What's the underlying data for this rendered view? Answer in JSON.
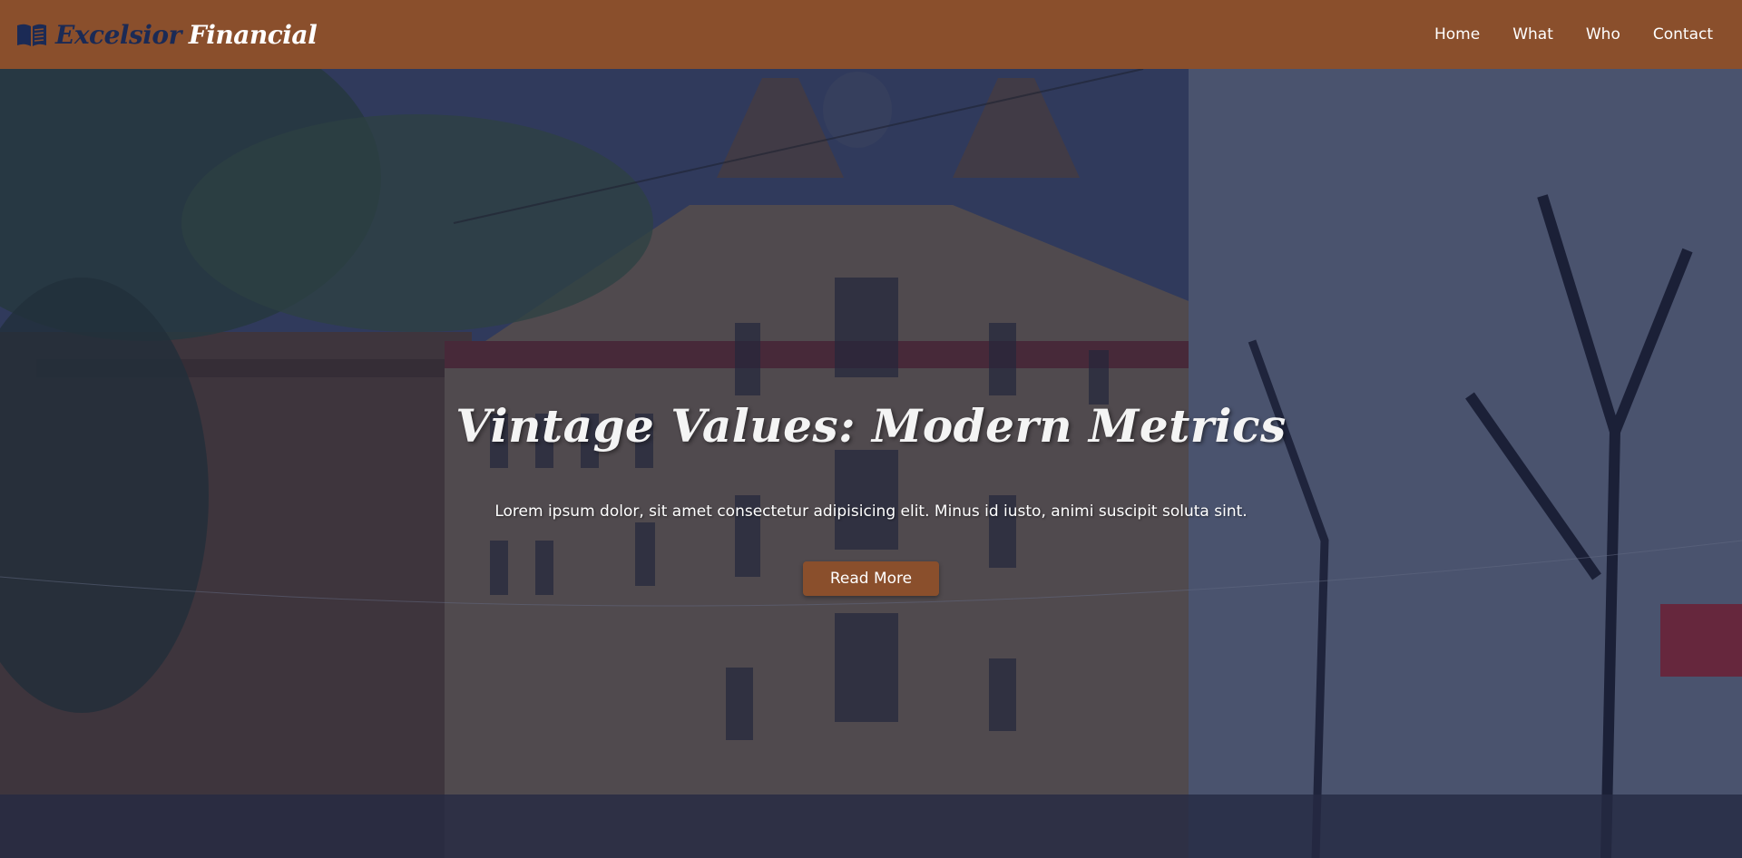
{
  "brand": {
    "word_1": "Excelsior",
    "word_2": "Financial",
    "icon": "open-book-icon"
  },
  "nav": {
    "items": [
      {
        "label": "Home"
      },
      {
        "label": "What"
      },
      {
        "label": "Who"
      },
      {
        "label": "Contact"
      }
    ]
  },
  "hero": {
    "title": "Vintage Values: Modern Metrics",
    "subtitle": "Lorem ipsum dolor, sit amet consectetur adipisicing elit. Minus id iusto, animi suscipit soluta sint.",
    "button_label": "Read More"
  },
  "colors": {
    "header_bg": "#8a4f2c",
    "brand_accent": "#1b2a55",
    "button_bg": "#8a4f2c",
    "overlay": "#1c2446"
  }
}
